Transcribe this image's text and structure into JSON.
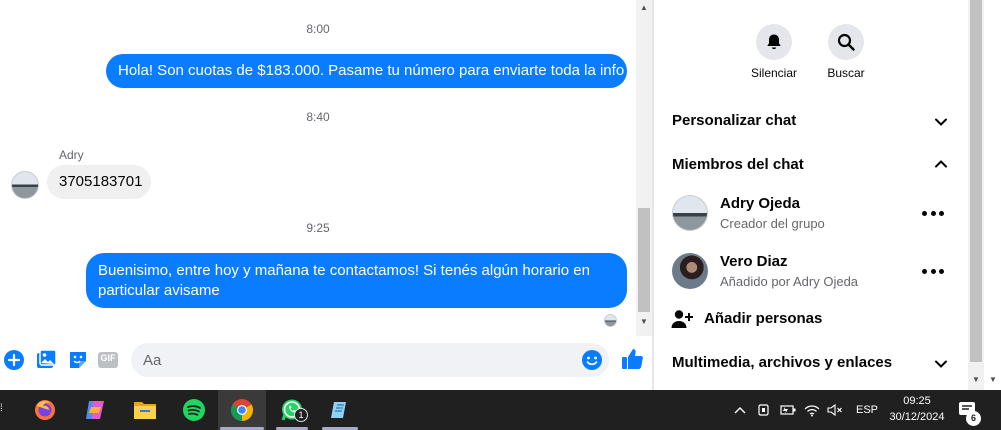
{
  "chat": {
    "messages": [
      {
        "time": "8:00",
        "text": "Hola! Son cuotas de $183.000. Pasame tu número para enviarte toda la info",
        "direction": "out"
      },
      {
        "time": "8:40",
        "sender": "Adry",
        "text": "3705183701",
        "direction": "in"
      },
      {
        "time": "9:25",
        "text_line1": "Buenisimo, entre hoy y mañana te contactamos! Si tenés algún horario en",
        "text_line2": "particular avisame",
        "direction": "out"
      }
    ]
  },
  "composer": {
    "placeholder": "Aa",
    "icons": [
      "plus-icon",
      "gallery-icon",
      "sticker-icon",
      "gif-icon",
      "emoji-icon",
      "like-icon"
    ],
    "gif_label": "GIF"
  },
  "panel": {
    "actions": [
      {
        "label": "Silenciar",
        "icon": "bell-icon"
      },
      {
        "label": "Buscar",
        "icon": "search-icon"
      }
    ],
    "sections": {
      "customize": "Personalizar chat",
      "members": "Miembros del chat",
      "media": "Multimedia, archivos y enlaces"
    },
    "members": [
      {
        "name": "Adry Ojeda",
        "role": "Creador del grupo"
      },
      {
        "name": "Vero Diaz",
        "role": "Añadido por Adry Ojeda"
      }
    ],
    "add_people": "Añadir personas"
  },
  "taskbar": {
    "apps": [
      "firefox-icon",
      "copilot-icon",
      "file-explorer-icon",
      "spotify-icon",
      "chrome-icon",
      "whatsapp-icon",
      "notepad-icon"
    ],
    "whatsapp_badge": "1",
    "language": "ESP",
    "time": "09:25",
    "date": "30/12/2024",
    "notification_count": "6"
  },
  "colors": {
    "accent": "#0a7cff",
    "bubble_in": "#f0f0f0",
    "taskbar": "#202020"
  }
}
